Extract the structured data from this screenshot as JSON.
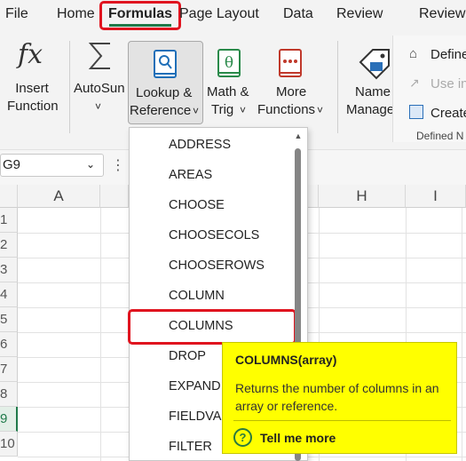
{
  "ribbon_tabs": [
    "File",
    "Home",
    "Formulas",
    "Page Layout",
    "Data",
    "Review",
    "Review"
  ],
  "active_tab": "Formulas",
  "ribbon": {
    "insert_function": {
      "line1": "Insert",
      "line2": "Function",
      "icon": "fx-icon"
    },
    "autosum": {
      "label": "AutoSun",
      "chevron": "˅",
      "icon": "sigma-icon"
    },
    "lookup": {
      "line1": "Lookup &",
      "line2": "Reference",
      "chevron": "˅",
      "icon": "book-search-icon"
    },
    "math": {
      "line1": "Math &",
      "line2": "Trig",
      "chevron": "˅",
      "icon": "theta-book-icon"
    },
    "more": {
      "line1": "More",
      "line2": "Functions",
      "chevron": "˅",
      "icon": "more-book-icon"
    },
    "name_manager": {
      "line1": "Name",
      "line2": "Manager",
      "icon": "tag-icon"
    },
    "define_name": "Define",
    "use_in_formula": "Use in",
    "create": "Create",
    "group_label": "Defined N"
  },
  "name_box": {
    "value": "G9"
  },
  "columns": [
    "A",
    "H",
    "I"
  ],
  "rows": [
    "1",
    "2",
    "3",
    "4",
    "5",
    "6",
    "7",
    "8",
    "9",
    "10"
  ],
  "dropdown_items": [
    "ADDRESS",
    "AREAS",
    "CHOOSE",
    "CHOOSECOLS",
    "CHOOSEROWS",
    "COLUMN",
    "COLUMNS",
    "DROP",
    "EXPAND",
    "FIELDVAL",
    "FILTER"
  ],
  "highlighted_item": "COLUMNS",
  "tooltip": {
    "title": "COLUMNS(array)",
    "description": "Returns the number of columns in an array or reference.",
    "link": "Tell me more",
    "help_icon": "?"
  },
  "colors": {
    "accent": "#1f7a4a",
    "highlight_box": "#e0141f",
    "tooltip_bg": "#ffff00"
  }
}
